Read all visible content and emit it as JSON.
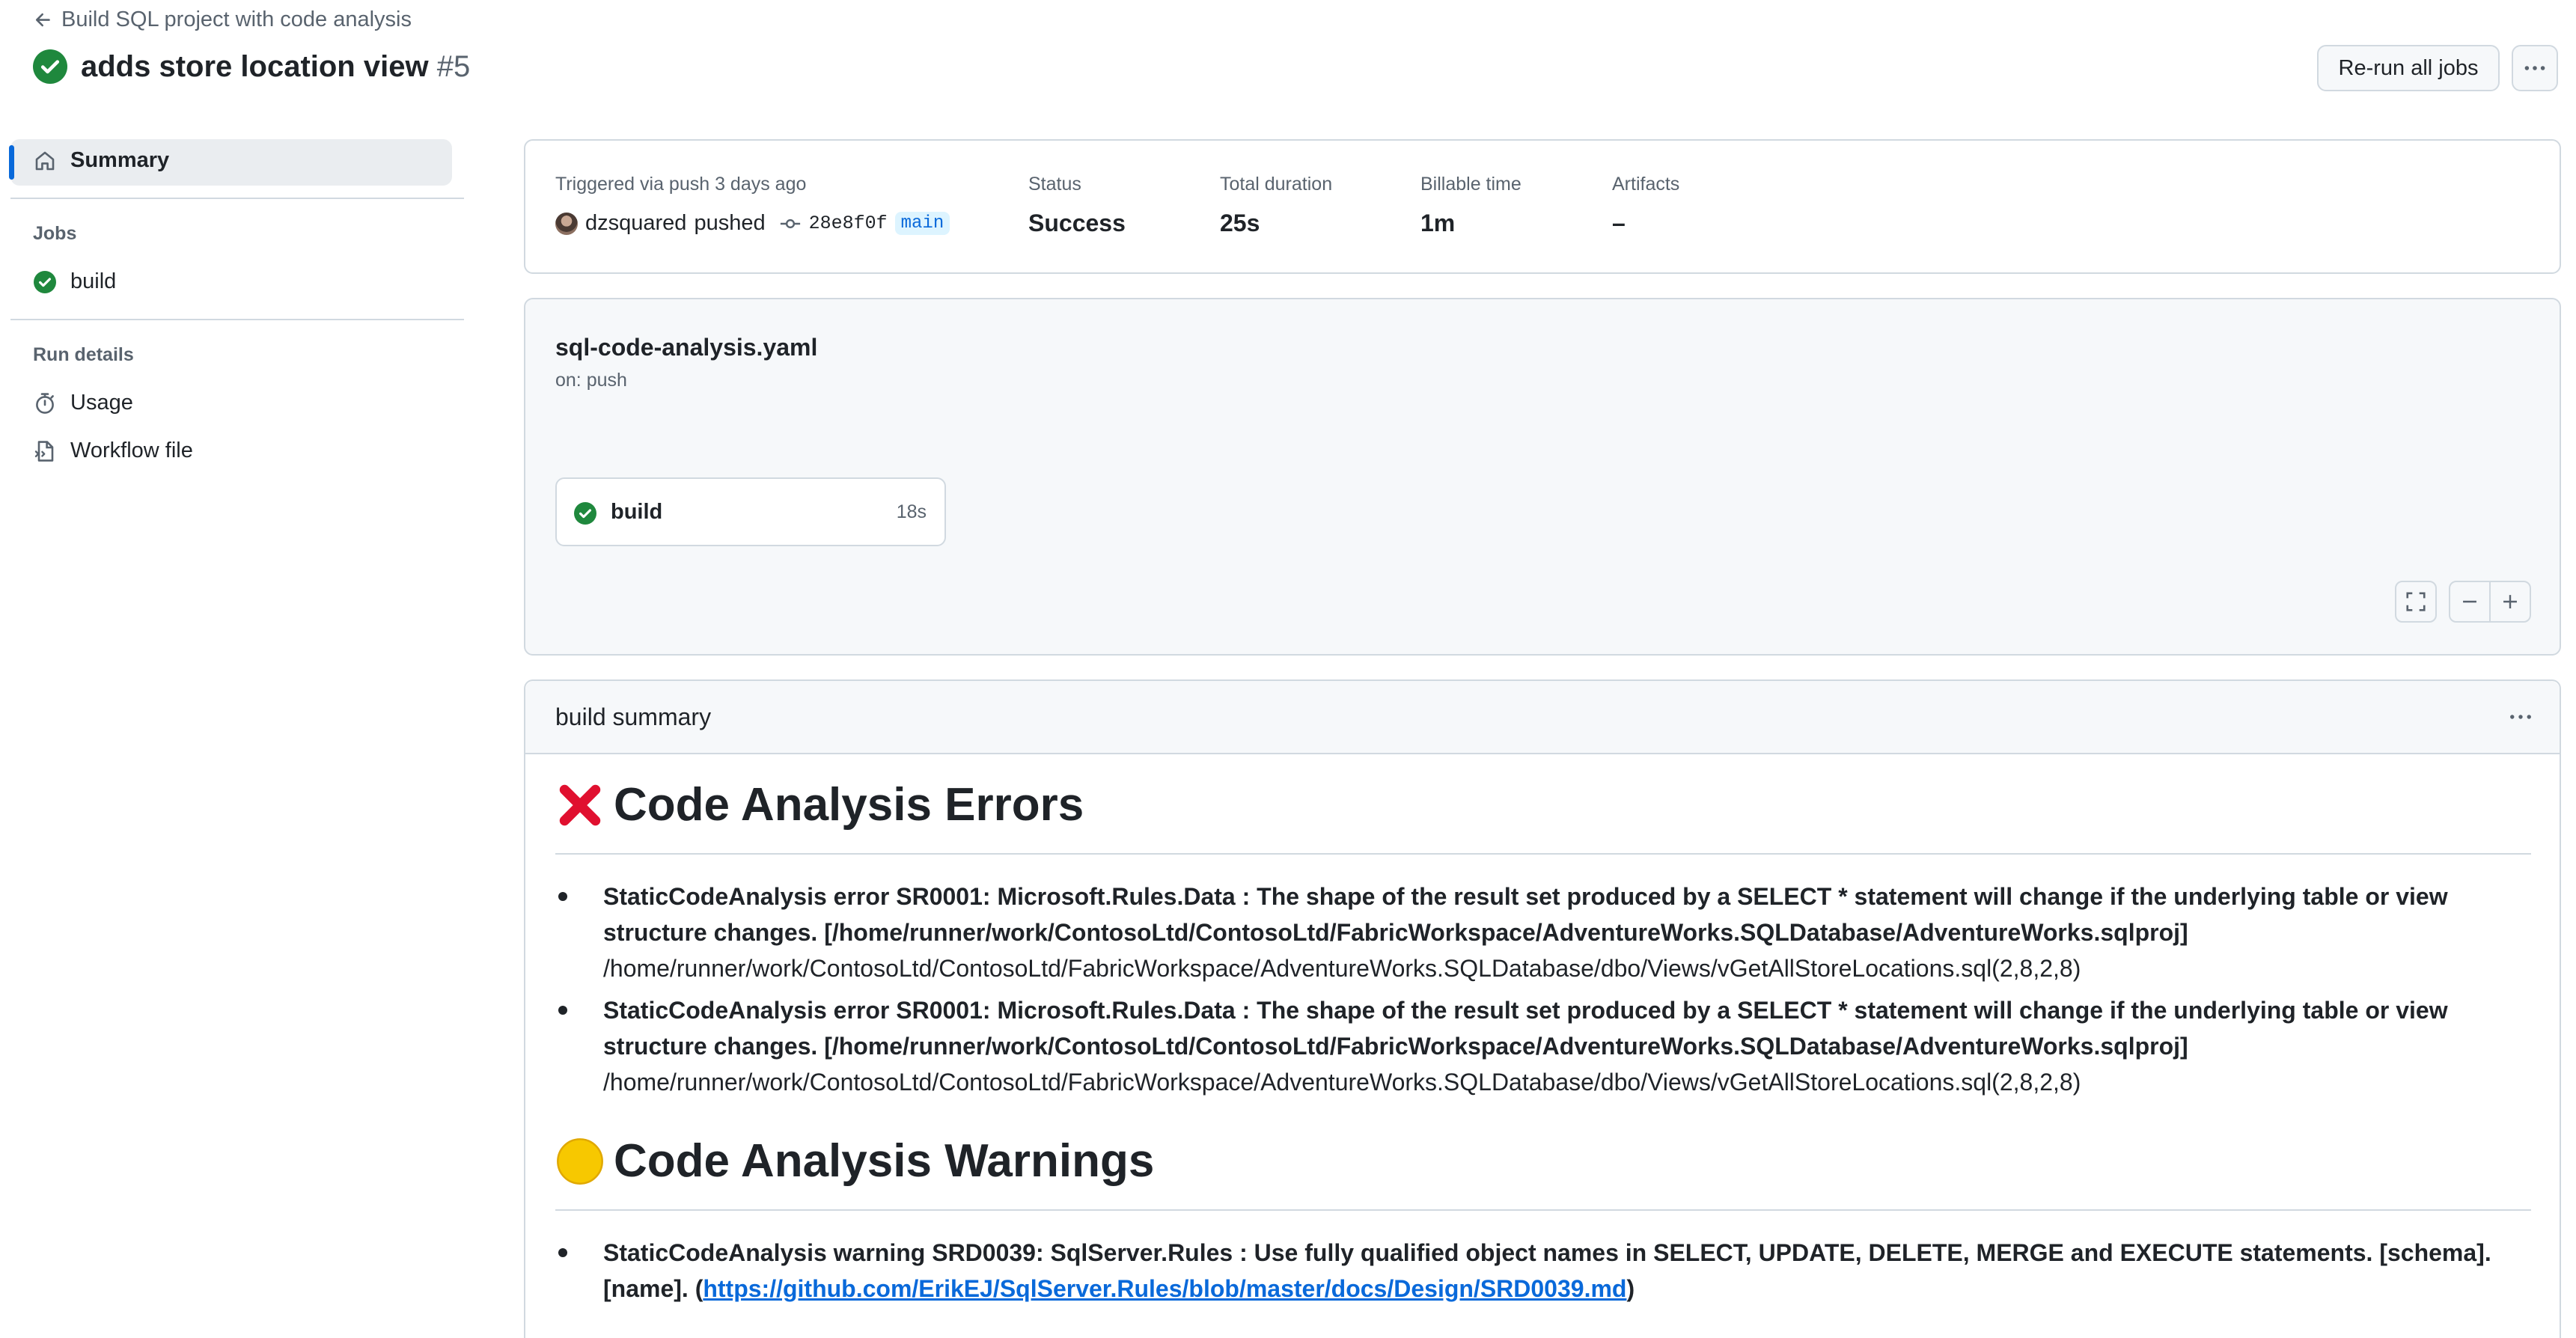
{
  "header": {
    "back_link": "Build SQL project with code analysis",
    "run_title": "adds store location view",
    "run_number": "#5",
    "rerun_label": "Re-run all jobs",
    "more_label": "···"
  },
  "sidebar": {
    "summary_label": "Summary",
    "jobs_heading": "Jobs",
    "jobs": [
      {
        "label": "build",
        "status": "success"
      }
    ],
    "run_details_heading": "Run details",
    "run_details": [
      {
        "label": "Usage",
        "icon": "stopwatch-icon"
      },
      {
        "label": "Workflow file",
        "icon": "file-code-icon"
      }
    ]
  },
  "run_info": {
    "trigger_label": "Triggered via push 3 days ago",
    "actor": "dzsquared",
    "action": "pushed",
    "commit_sha": "28e8f0f",
    "branch": "main",
    "status_label": "Status",
    "status_value": "Success",
    "duration_label": "Total duration",
    "duration_value": "25s",
    "billable_label": "Billable time",
    "billable_value": "1m",
    "artifacts_label": "Artifacts",
    "artifacts_value": "–"
  },
  "workflow": {
    "file_name": "sql-code-analysis.yaml",
    "trigger": "on: push",
    "job": {
      "name": "build",
      "duration": "18s",
      "status": "success"
    }
  },
  "summary": {
    "title": "build summary",
    "errors_heading": "Code Analysis Errors",
    "errors": [
      {
        "bold": "StaticCodeAnalysis error SR0001: Microsoft.Rules.Data : The shape of the result set produced by a SELECT * statement will change if the underlying table or view structure changes. [/home/runner/work/ContosoLtd/ContosoLtd/FabricWorkspace/AdventureWorks.SQLDatabase/AdventureWorks.sqlproj]",
        "path": "/home/runner/work/ContosoLtd/ContosoLtd/FabricWorkspace/AdventureWorks.SQLDatabase/dbo/Views/vGetAllStoreLocations.sql(2,8,2,8)"
      },
      {
        "bold": "StaticCodeAnalysis error SR0001: Microsoft.Rules.Data : The shape of the result set produced by a SELECT * statement will change if the underlying table or view structure changes. [/home/runner/work/ContosoLtd/ContosoLtd/FabricWorkspace/AdventureWorks.SQLDatabase/AdventureWorks.sqlproj]",
        "path": "/home/runner/work/ContosoLtd/ContosoLtd/FabricWorkspace/AdventureWorks.SQLDatabase/dbo/Views/vGetAllStoreLocations.sql(2,8,2,8)"
      }
    ],
    "warnings_heading": "Code Analysis Warnings",
    "warnings": [
      {
        "bold": "StaticCodeAnalysis warning SRD0039: SqlServer.Rules : Use fully qualified object names in SELECT, UPDATE, DELETE, MERGE and EXECUTE statements. [schema].[name]. (",
        "link": "https://github.com/ErikEJ/SqlServer.Rules/blob/master/docs/Design/SRD0039.md",
        "tail": ")"
      }
    ]
  },
  "colors": {
    "success": "#1f883d",
    "accent": "#0969da",
    "error_x": "#e0102f",
    "warning_dot": "#f7c800"
  }
}
